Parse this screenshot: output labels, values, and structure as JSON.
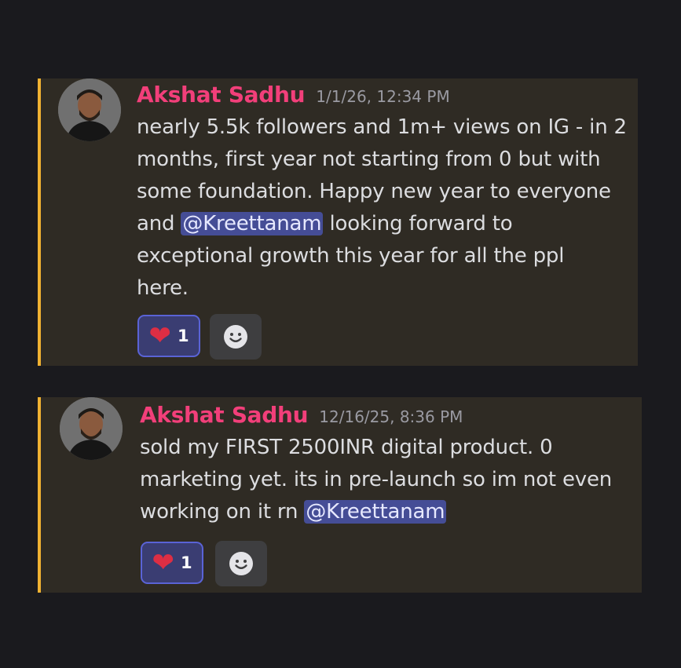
{
  "colors": {
    "background": "#1a1a1e",
    "message_bg": "#2f2b24",
    "highlight_bar": "#f0b232",
    "author": "#f23f7a",
    "mention_bg": "#454d96",
    "reaction_border": "#5a63d6"
  },
  "messages": [
    {
      "author": "Akshat Sadhu",
      "timestamp": "1/1/26, 12:34 PM",
      "lines": [
        "nearly 5.5k followers and 1m+ views on IG - in 2",
        "months, first year not starting from 0 but with",
        "some foundation. Happy new year to everyone"
      ],
      "line4_before": "and ",
      "mention": "@Kreettanam",
      "line4_after": " looking forward to",
      "lines_after": [
        "exceptional growth this year for all the ppl",
        "here."
      ],
      "reaction": {
        "icon": "heart-icon",
        "count": "1"
      },
      "add_reaction_icon": "smiley-icon"
    },
    {
      "author": "Akshat Sadhu",
      "timestamp": "12/16/25, 8:36 PM",
      "lines": [
        "sold my FIRST 2500INR digital product. 0",
        "marketing yet. its in pre-launch so im not even"
      ],
      "line3_before": "working on it rn ",
      "mention": "@Kreettanam",
      "reaction": {
        "icon": "heart-icon",
        "count": "1"
      },
      "add_reaction_icon": "smiley-icon"
    }
  ]
}
